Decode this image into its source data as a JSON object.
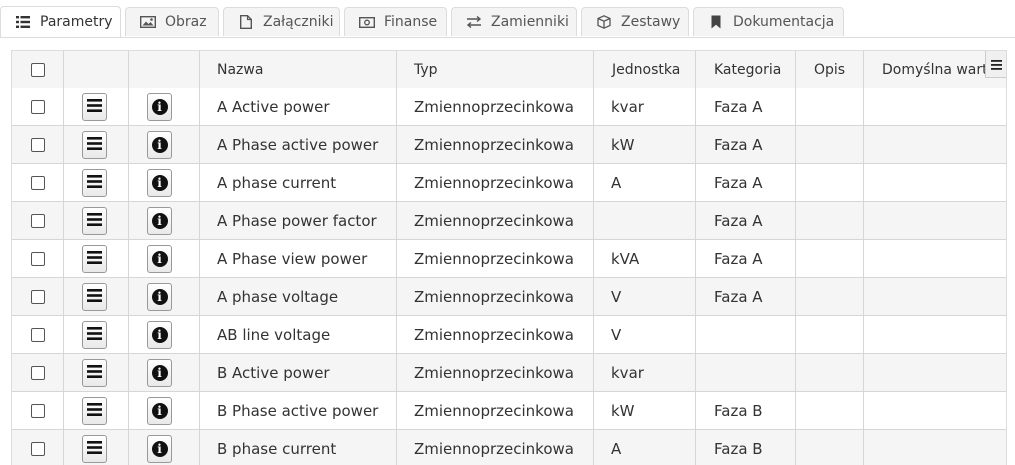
{
  "tabs": [
    {
      "label": "Parametry",
      "icon": "list-icon",
      "active": true
    },
    {
      "label": "Obraz",
      "icon": "image-icon"
    },
    {
      "label": "Załączniki",
      "icon": "file-icon"
    },
    {
      "label": "Finanse",
      "icon": "money-icon"
    },
    {
      "label": "Zamienniki",
      "icon": "swap-icon"
    },
    {
      "label": "Zestawy",
      "icon": "box-icon"
    },
    {
      "label": "Dokumentacja",
      "icon": "bookmark-icon"
    }
  ],
  "table": {
    "headers": {
      "name": "Nazwa",
      "type": "Typ",
      "unit": "Jednostka",
      "category": "Kategoria",
      "description": "Opis",
      "default": "Domyślna wartość"
    },
    "rows": [
      {
        "name": "A Active power",
        "type": "Zmiennoprzecinkowa",
        "unit": "kvar",
        "category": "Faza A",
        "description": "",
        "default": ""
      },
      {
        "name": "A Phase active power",
        "type": "Zmiennoprzecinkowa",
        "unit": "kW",
        "category": "Faza A",
        "description": "",
        "default": ""
      },
      {
        "name": "A phase current",
        "type": "Zmiennoprzecinkowa",
        "unit": "A",
        "category": "Faza A",
        "description": "",
        "default": ""
      },
      {
        "name": "A Phase power factor",
        "type": "Zmiennoprzecinkowa",
        "unit": "",
        "category": "Faza A",
        "description": "",
        "default": ""
      },
      {
        "name": "A Phase view power",
        "type": "Zmiennoprzecinkowa",
        "unit": "kVA",
        "category": "Faza A",
        "description": "",
        "default": ""
      },
      {
        "name": "A phase voltage",
        "type": "Zmiennoprzecinkowa",
        "unit": "V",
        "category": "Faza A",
        "description": "",
        "default": ""
      },
      {
        "name": "AB line voltage",
        "type": "Zmiennoprzecinkowa",
        "unit": "V",
        "category": "",
        "description": "",
        "default": ""
      },
      {
        "name": "B Active power",
        "type": "Zmiennoprzecinkowa",
        "unit": "kvar",
        "category": "",
        "description": "",
        "default": ""
      },
      {
        "name": "B Phase active power",
        "type": "Zmiennoprzecinkowa",
        "unit": "kW",
        "category": "Faza B",
        "description": "",
        "default": ""
      },
      {
        "name": "B phase current",
        "type": "Zmiennoprzecinkowa",
        "unit": "A",
        "category": "Faza B",
        "description": "",
        "default": ""
      }
    ],
    "info_glyph": "i"
  }
}
